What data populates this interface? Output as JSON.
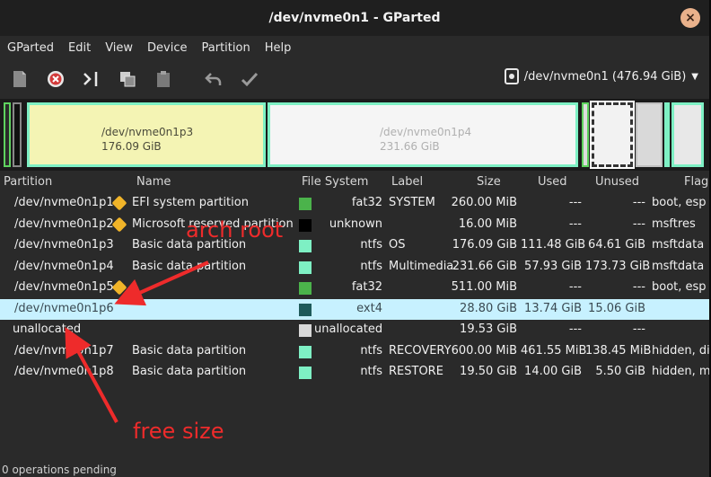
{
  "window": {
    "title": "/dev/nvme0n1 - GParted",
    "close_label": "×"
  },
  "menu": [
    "GParted",
    "Edit",
    "View",
    "Device",
    "Partition",
    "Help"
  ],
  "toolbar": {
    "icons": [
      "new-icon",
      "delete-icon",
      "resize-icon",
      "copy-icon",
      "paste-icon",
      "undo-icon",
      "apply-icon"
    ],
    "device": "/dev/nvme0n1 (476.94 GiB)"
  },
  "partition_map": [
    {
      "name": "/dev/nvme0n1p3",
      "size": "176.09 GiB"
    },
    {
      "name": "/dev/nvme0n1p4",
      "size": "231.66 GiB"
    }
  ],
  "columns": {
    "partition": "Partition",
    "name": "Name",
    "filesystem": "File System",
    "label": "Label",
    "size": "Size",
    "used": "Used",
    "unused": "Unused",
    "flags": "Flag"
  },
  "rows": [
    {
      "partition": "/dev/nvme0n1p1",
      "warn": true,
      "name": "EFI system partition",
      "fs_color": "#4bb34b",
      "fs": "fat32",
      "label": "SYSTEM",
      "size": "260.00 MiB",
      "used": "---",
      "unused": "---",
      "flags": "boot, esp"
    },
    {
      "partition": "/dev/nvme0n1p2",
      "warn": true,
      "name": "Microsoft reserved partition",
      "fs_color": "#000000",
      "fs": "unknown",
      "label": "",
      "size": "16.00 MiB",
      "used": "---",
      "unused": "---",
      "flags": "msftres"
    },
    {
      "partition": "/dev/nvme0n1p3",
      "warn": false,
      "name": "Basic data partition",
      "fs_color": "#7ef0c4",
      "fs": "ntfs",
      "label": "OS",
      "size": "176.09 GiB",
      "used": "111.48 GiB",
      "unused": "64.61 GiB",
      "flags": "msftdata"
    },
    {
      "partition": "/dev/nvme0n1p4",
      "warn": false,
      "name": "Basic data partition",
      "fs_color": "#7ef0c4",
      "fs": "ntfs",
      "label": "Multimedia",
      "size": "231.66 GiB",
      "used": "57.93 GiB",
      "unused": "173.73 GiB",
      "flags": "msftdata"
    },
    {
      "partition": "/dev/nvme0n1p5",
      "warn": true,
      "name": "",
      "fs_color": "#4bb34b",
      "fs": "fat32",
      "label": "",
      "size": "511.00 MiB",
      "used": "---",
      "unused": "---",
      "flags": "boot, esp"
    },
    {
      "partition": "/dev/nvme0n1p6",
      "warn": false,
      "name": "",
      "fs_color": "#1f5a5a",
      "fs": "ext4",
      "label": "",
      "size": "28.80 GiB",
      "used": "13.74 GiB",
      "unused": "15.06 GiB",
      "flags": "",
      "selected": true
    },
    {
      "partition": "unallocated",
      "warn": false,
      "name": "",
      "fs_color": "#d8d8d8",
      "fs": "unallocated",
      "label": "",
      "size": "19.53 GiB",
      "used": "---",
      "unused": "---",
      "flags": ""
    },
    {
      "partition": "/dev/nvme0n1p7",
      "warn": false,
      "name": "Basic data partition",
      "fs_color": "#7ef0c4",
      "fs": "ntfs",
      "label": "RECOVERY",
      "size": "600.00 MiB",
      "used": "461.55 MiB",
      "unused": "138.45 MiB",
      "flags": "hidden, di"
    },
    {
      "partition": "/dev/nvme0n1p8",
      "warn": false,
      "name": "Basic data partition",
      "fs_color": "#7ef0c4",
      "fs": "ntfs",
      "label": "RESTORE",
      "size": "19.50 GiB",
      "used": "14.00 GiB",
      "unused": "5.50 GiB",
      "flags": "hidden, m"
    }
  ],
  "status": "0 operations pending",
  "annotations": {
    "arch_root": "arch root",
    "free_size": "free size",
    "color": "#ee2b2b"
  }
}
